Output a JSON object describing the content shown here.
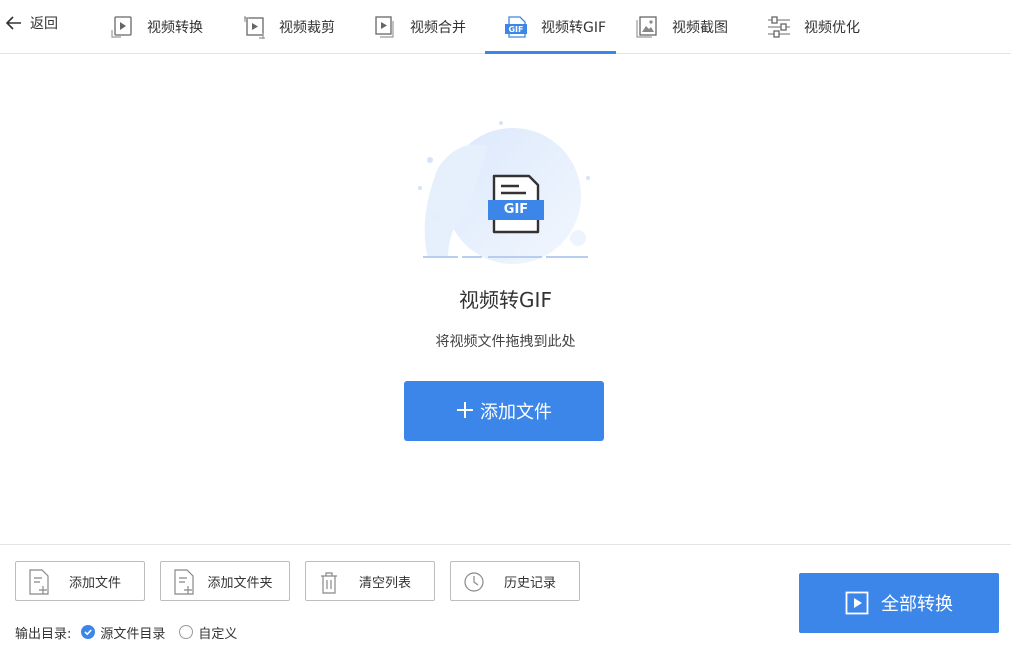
{
  "nav": {
    "back_label": "返回",
    "tabs": [
      {
        "label": "视频转换",
        "icon": "video-convert-icon"
      },
      {
        "label": "视频裁剪",
        "icon": "video-crop-icon"
      },
      {
        "label": "视频合并",
        "icon": "video-merge-icon"
      },
      {
        "label": "视频转GIF",
        "icon": "gif-icon",
        "active": true
      },
      {
        "label": "视频截图",
        "icon": "image-icon"
      },
      {
        "label": "视频优化",
        "icon": "sliders-icon"
      }
    ]
  },
  "drop": {
    "badge": "GIF",
    "title": "视频转GIF",
    "subtitle": "将视频文件拖拽到此处",
    "add_button": "添加文件"
  },
  "toolbar": {
    "add_file": "添加文件",
    "add_folder": "添加文件夹",
    "clear_list": "清空列表",
    "history": "历史记录"
  },
  "output": {
    "label": "输出目录:",
    "option_source": "源文件目录",
    "option_custom": "自定义",
    "selected": "源文件目录"
  },
  "convert_all": "全部转换",
  "colors": {
    "accent": "#3b86e8",
    "border": "#bdbdbd"
  }
}
